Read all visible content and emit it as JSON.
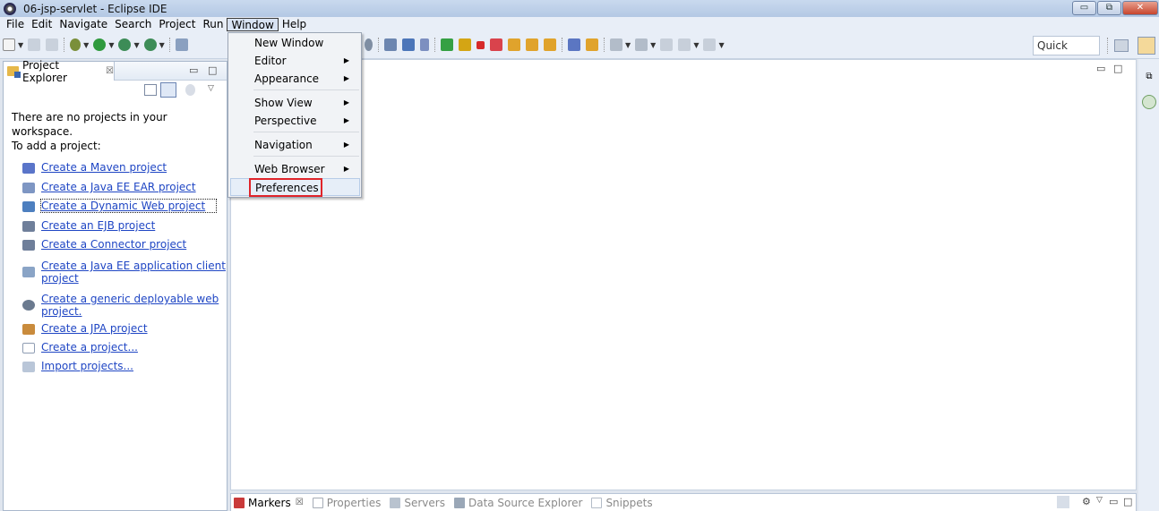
{
  "window": {
    "title": "06-jsp-servlet - Eclipse IDE",
    "controls": {
      "minimize": "▭",
      "maximize": "⧉",
      "close": "✕"
    }
  },
  "menubar": {
    "items": [
      "File",
      "Edit",
      "Navigate",
      "Search",
      "Project",
      "Run",
      "Window",
      "Help"
    ],
    "active": "Window"
  },
  "toolbar": {
    "quick_access": "Quick Access"
  },
  "window_menu": {
    "items": [
      {
        "label": "New Window",
        "submenu": false
      },
      {
        "label": "Editor",
        "submenu": true
      },
      {
        "label": "Appearance",
        "submenu": true
      },
      {
        "label": "Show View",
        "submenu": true
      },
      {
        "label": "Perspective",
        "submenu": true
      },
      {
        "label": "Navigation",
        "submenu": true
      },
      {
        "label": "Web Browser",
        "submenu": true
      },
      {
        "label": "Preferences",
        "submenu": false
      }
    ],
    "highlighted": "Preferences"
  },
  "project_explorer": {
    "tab_label": "Project Explorer",
    "tab_close": "☒",
    "message_line1": "There are no projects in your workspace.",
    "message_line2": "To add a project:",
    "links": [
      {
        "label": "Create a Maven project",
        "icon": "maven-icon"
      },
      {
        "label": "Create a Java EE EAR project",
        "icon": "ear-project-icon"
      },
      {
        "label": "Create a Dynamic Web project",
        "icon": "web-project-icon"
      },
      {
        "label": "Create an EJB project",
        "icon": "ejb-project-icon"
      },
      {
        "label": "Create a Connector project",
        "icon": "connector-project-icon"
      },
      {
        "label": "Create a Java EE application client",
        "label2": "project",
        "icon": "app-client-icon"
      },
      {
        "label": "Create a generic deployable web",
        "label2": "project.",
        "icon": "generic-web-icon"
      },
      {
        "label": "Create a JPA project",
        "icon": "jpa-project-icon"
      },
      {
        "label": "Create a project...",
        "icon": "new-project-icon"
      },
      {
        "label": "Import projects...",
        "icon": "import-icon"
      }
    ]
  },
  "bottom_panel": {
    "tabs": [
      {
        "label": "Markers",
        "active": true,
        "suffix": "☒"
      },
      {
        "label": "Properties",
        "active": false
      },
      {
        "label": "Servers",
        "active": false
      },
      {
        "label": "Data Source Explorer",
        "active": false
      },
      {
        "label": "Snippets",
        "active": false
      }
    ]
  },
  "colors": {
    "accent_link": "#1f46c4",
    "highlight_box": "#e0242a",
    "titlebar": "#b3c8e4"
  }
}
